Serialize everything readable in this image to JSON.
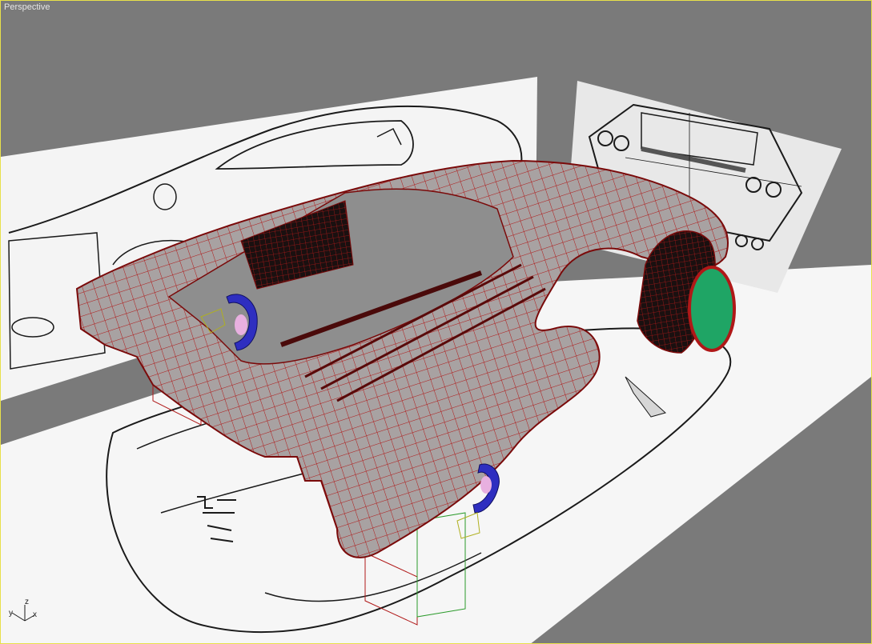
{
  "viewport": {
    "label": "Perspective",
    "border_color": "#e8e04a",
    "background_color": "#7a7a7a"
  },
  "scene": {
    "reference_planes": [
      "side-view-blueprint-plane",
      "rear-view-blueprint-plane",
      "top-view-blueprint-plane"
    ],
    "model": "car-body-mesh",
    "mesh_fill_color": "#a8a2a2",
    "wireframe_color": "#b01818",
    "wheel_color": "#1fa565",
    "helper_color": "#3a3ab0"
  },
  "axis_gizmo": {
    "x": "x",
    "y": "y",
    "z": "z"
  }
}
